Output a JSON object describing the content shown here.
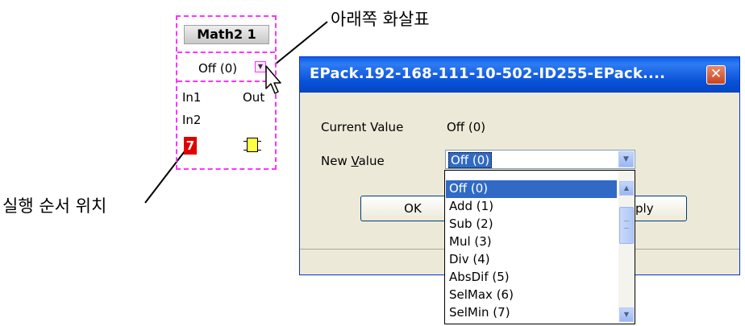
{
  "annotations": {
    "down_arrow_label": "아래쪽 화살표",
    "exec_order_label": "실행 순서 위치"
  },
  "block": {
    "title": "Math2 1",
    "mode_value": "Off (0)",
    "inputs": [
      "In1",
      "In2"
    ],
    "output": "Out",
    "exec_order": "7"
  },
  "dialog": {
    "title": "EPack.192-168-111-10-502-ID255-EPack....",
    "close_symbol": "✕",
    "current_value_label": "Current Value",
    "current_value": "Off (0)",
    "new_value_label": "New Value",
    "new_value_label_mnemonic": "V",
    "new_value_selected": "Off (0)",
    "ok_label": "OK",
    "apply_label_visible": "ply"
  },
  "dropdown": {
    "options": [
      "Off (0)",
      "Add (1)",
      "Sub (2)",
      "Mul (3)",
      "Div (4)",
      "AbsDif (5)",
      "SelMax (6)",
      "SelMin (7)"
    ],
    "selected_index": 0
  },
  "colors": {
    "block_border": "#ff33ff",
    "exec_order_bg": "#e00000",
    "titlebar": "#0851d6",
    "selection": "#316ac5"
  },
  "icons": [
    "chip-icon",
    "cursor-icon",
    "close-icon",
    "chevron-down-icon",
    "scroll-up-icon",
    "scroll-down-icon"
  ]
}
